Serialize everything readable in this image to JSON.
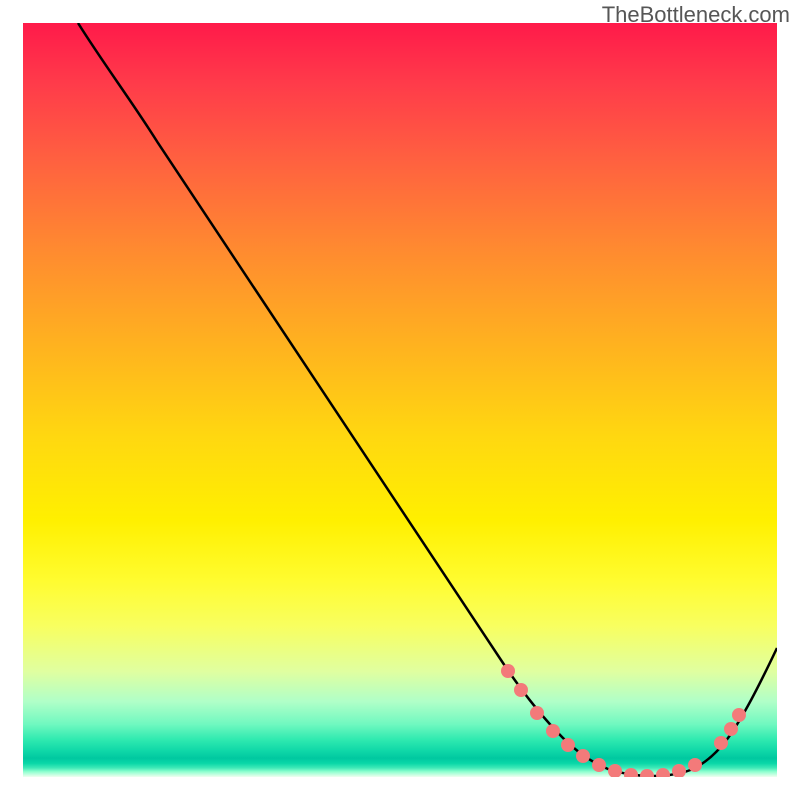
{
  "watermark": "TheBottleneck.com",
  "chart_data": {
    "type": "line",
    "title": "",
    "xlabel": "",
    "ylabel": "",
    "xlim": [
      0,
      100
    ],
    "ylim": [
      0,
      100
    ],
    "background": "rainbow-gradient-red-to-green-vertical",
    "series": [
      {
        "name": "bottleneck-curve",
        "color": "#000000",
        "x": [
          8,
          12,
          18,
          24,
          30,
          36,
          42,
          48,
          54,
          60,
          64,
          68,
          72,
          76,
          80,
          84,
          88,
          92,
          96,
          100
        ],
        "y": [
          100,
          94,
          86,
          78,
          70,
          62,
          54,
          46,
          38,
          30,
          22,
          15,
          9,
          5,
          3,
          2,
          3,
          6,
          12,
          22
        ]
      }
    ],
    "markers": {
      "name": "highlighted-points",
      "color": "#f37a7a",
      "points_x": [
        60,
        62,
        66,
        70,
        72,
        74,
        77,
        80,
        82,
        84,
        86,
        88,
        90,
        90.5,
        91
      ],
      "points_y": [
        18,
        15,
        10,
        6,
        5,
        4,
        3,
        2.5,
        2.5,
        2.5,
        3,
        4,
        6,
        9,
        12
      ]
    }
  }
}
